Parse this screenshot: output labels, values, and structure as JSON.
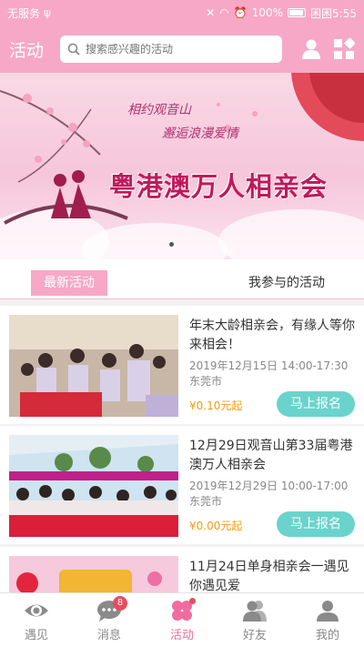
{
  "status_bar": {
    "carrier": "无服务",
    "battery_percent": "100%",
    "time_label": "困困5:55"
  },
  "header": {
    "title": "活动",
    "search_placeholder": "搜索感兴趣的活动"
  },
  "banner": {
    "line1": "相约观音山",
    "line2": "邂逅浪漫爱情",
    "headline": "粤港澳万人相亲会"
  },
  "tabs": [
    {
      "label": "最新活动",
      "active": true
    },
    {
      "label": "我参与的活动",
      "active": false
    }
  ],
  "events": [
    {
      "title": "年末大龄相亲会，有缘人等你来相会！",
      "datetime": "2019年12月15日 14:00-17:30",
      "location": "东莞市",
      "price": "¥0.10元起",
      "button": "马上报名"
    },
    {
      "title": "12月29日观音山第33届粤港澳万人相亲会",
      "datetime": "2019年12月29日 10:00-17:00",
      "location": "东莞市",
      "price": "¥0.00元起",
      "button": "马上报名"
    },
    {
      "title": "11月24日单身相亲会一遇见你遇见爱",
      "datetime": "",
      "location": "",
      "price": "",
      "button": ""
    }
  ],
  "bottom_nav": [
    {
      "label": "遇见",
      "icon": "eye-icon",
      "badge": ""
    },
    {
      "label": "消息",
      "icon": "chat-icon",
      "badge": "8"
    },
    {
      "label": "活动",
      "icon": "clover-icon",
      "badge": "dot",
      "active": true
    },
    {
      "label": "好友",
      "icon": "friends-icon",
      "badge": ""
    },
    {
      "label": "我的",
      "icon": "person-icon",
      "badge": ""
    }
  ],
  "colors": {
    "brand_pink": "#f7a8c6",
    "active_pink": "#f06ca0",
    "button_teal": "#6ad3cc",
    "price_orange": "#f39c12"
  }
}
